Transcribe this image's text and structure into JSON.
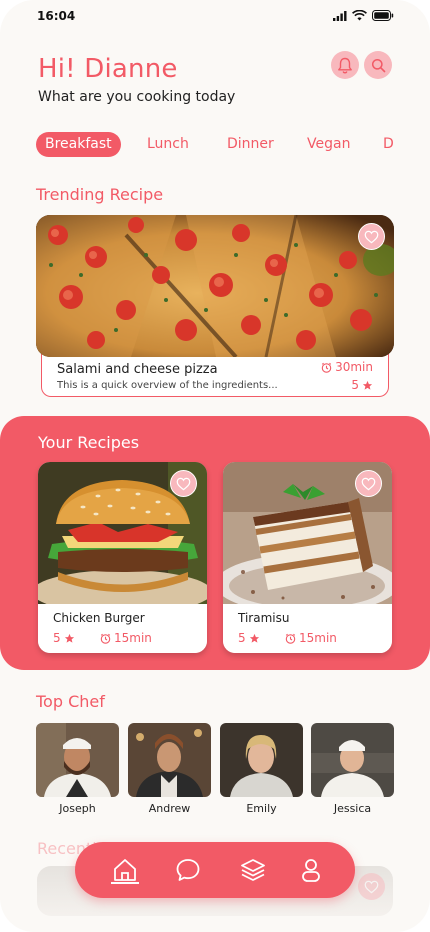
{
  "status": {
    "time": "16:04"
  },
  "header": {
    "greeting": "Hi! Dianne",
    "subtitle": "What are you cooking today"
  },
  "tabs": [
    {
      "label": "Breakfast",
      "active": true
    },
    {
      "label": "Lunch"
    },
    {
      "label": "Dinner"
    },
    {
      "label": "Vegan"
    },
    {
      "label": "Dessert"
    }
  ],
  "trending": {
    "title": "Trending Recipe",
    "recipe": {
      "name": "Salami and cheese pizza",
      "description": "This is a quick overview of the ingredients...",
      "time": "30min",
      "rating": "5"
    }
  },
  "your_recipes": {
    "title": "Your Recipes",
    "items": [
      {
        "name": "Chicken Burger",
        "rating": "5",
        "time": "15min"
      },
      {
        "name": "Tiramisu",
        "rating": "5",
        "time": "15min"
      }
    ]
  },
  "top_chef": {
    "title": "Top Chef",
    "chefs": [
      {
        "name": "Joseph"
      },
      {
        "name": "Andrew"
      },
      {
        "name": "Emily"
      },
      {
        "name": "Jessica"
      }
    ]
  },
  "recent": {
    "title": "Recently Added"
  },
  "nav": {
    "items": [
      {
        "icon": "home-icon",
        "active": true
      },
      {
        "icon": "chat-icon"
      },
      {
        "icon": "layers-icon"
      },
      {
        "icon": "profile-icon"
      }
    ]
  },
  "colors": {
    "accent": "#f25a66",
    "accent_light": "#f8b8bd",
    "background": "#fbf9f6"
  }
}
